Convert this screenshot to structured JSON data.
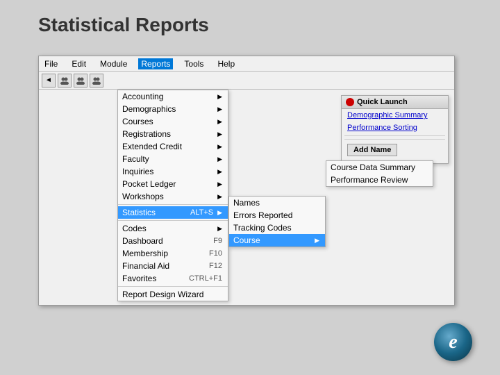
{
  "page": {
    "title": "Statistical Reports",
    "background": "#d0d0d0"
  },
  "menubar": {
    "items": [
      {
        "label": "File",
        "id": "file"
      },
      {
        "label": "Edit",
        "id": "edit"
      },
      {
        "label": "Module",
        "id": "module"
      },
      {
        "label": "Reports",
        "id": "reports",
        "active": true
      },
      {
        "label": "Tools",
        "id": "tools"
      },
      {
        "label": "Help",
        "id": "help"
      }
    ]
  },
  "toolbar": {
    "buttons": [
      "◄",
      "👥",
      "👥",
      "👥"
    ]
  },
  "reports_menu": {
    "items": [
      {
        "label": "Accounting",
        "has_arrow": true
      },
      {
        "label": "Demographics",
        "has_arrow": true
      },
      {
        "label": "Courses",
        "has_arrow": true
      },
      {
        "label": "Registrations",
        "has_arrow": true
      },
      {
        "label": "Extended Credit",
        "has_arrow": true
      },
      {
        "label": "Faculty",
        "has_arrow": true
      },
      {
        "label": "Inquiries",
        "has_arrow": true
      },
      {
        "label": "Pocket Ledger",
        "has_arrow": true
      },
      {
        "label": "Workshops",
        "has_arrow": true
      },
      {
        "separator": true
      },
      {
        "label": "Statistics",
        "shortcut": "ALT+S",
        "has_arrow": true,
        "highlighted": true
      },
      {
        "separator": true
      },
      {
        "label": "Codes",
        "has_arrow": true
      },
      {
        "label": "Dashboard",
        "shortcut": "F9"
      },
      {
        "label": "Membership",
        "shortcut": "F10"
      },
      {
        "label": "Financial Aid",
        "shortcut": "F12"
      },
      {
        "label": "Favorites",
        "shortcut": "CTRL+F1"
      },
      {
        "separator": true
      },
      {
        "label": "Report Design Wizard"
      }
    ]
  },
  "statistics_submenu": {
    "items": [
      {
        "label": "Names"
      },
      {
        "label": "Errors Reported"
      },
      {
        "label": "Tracking Codes"
      },
      {
        "label": "Course",
        "has_arrow": true,
        "selected": true
      }
    ]
  },
  "course_submenu": {
    "items": [
      {
        "label": "Course Data Summary"
      },
      {
        "label": "Performance Review"
      }
    ]
  },
  "quick_launch": {
    "title": "Quick Launch",
    "items": [
      {
        "label": "Demographic Summary"
      },
      {
        "label": "Performance Sorting"
      }
    ],
    "add_button": "Add Name"
  },
  "logo": {
    "symbol": "e"
  }
}
